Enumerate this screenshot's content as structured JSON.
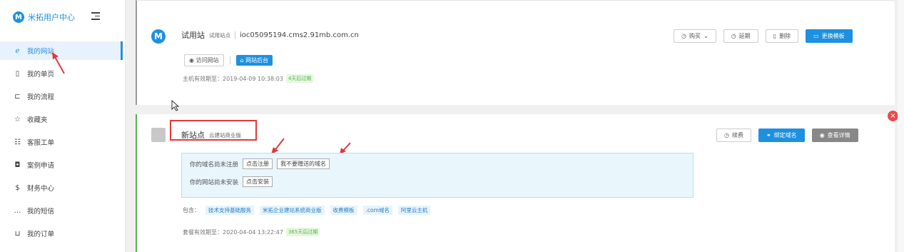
{
  "sidebar": {
    "logo_letter": "M",
    "title": "米拓用户中心",
    "items": [
      {
        "label": "我的网站",
        "icon": "ie-icon",
        "glyph": "ℯ",
        "active": true
      },
      {
        "label": "我的单页",
        "icon": "page-icon",
        "glyph": "▯"
      },
      {
        "label": "我的流程",
        "icon": "flow-icon",
        "glyph": "⊏"
      },
      {
        "label": "收藏夹",
        "icon": "star-icon",
        "glyph": "☆"
      },
      {
        "label": "客服工单",
        "icon": "ticket-icon",
        "glyph": "☷"
      },
      {
        "label": "案例申请",
        "icon": "camera-icon",
        "glyph": "◘"
      },
      {
        "label": "财务中心",
        "icon": "money-icon",
        "glyph": "$"
      },
      {
        "label": "我的短信",
        "icon": "chat-icon",
        "glyph": "…"
      },
      {
        "label": "我的订单",
        "icon": "cart-icon",
        "glyph": "⊔"
      }
    ]
  },
  "site1": {
    "logo_letter": "M",
    "title": "试用站",
    "tag": "试用站点",
    "domain": "ioc05095194.cms2.91mb.com.cn",
    "visit_label": "访问网站",
    "admin_label": "网站后台",
    "expire_label": "主机有效期至：2019-04-09 10:38:03",
    "expire_badge": "4天后过期",
    "buttons": {
      "buy": "购买",
      "extend": "延期",
      "delete": "删除",
      "change_template": "更换模板"
    }
  },
  "site2": {
    "title": "新站点",
    "tag": "云建站商业版",
    "domain_notice": "你的域名尚未注册",
    "register_btn": "点击注册",
    "no_gift_domain_btn": "我不要赠送的域名",
    "install_notice": "你的网站尚未安装",
    "install_btn": "点击安装",
    "include_label": "包含：",
    "includes": [
      "技术支持基础服务",
      "米拓企业建站系统商业版",
      "收费模板",
      ".com域名",
      "阿里云主机"
    ],
    "expire_label": "套餐有效期至：2020-04-04 13:22:47",
    "expire_badge": "365天后过期",
    "buttons": {
      "renew": "续费",
      "bind_domain": "绑定域名",
      "details": "查看详情"
    }
  },
  "colors": {
    "accent": "#1e90e0",
    "success": "#55b44c",
    "annotation_red": "#e03a3a"
  }
}
